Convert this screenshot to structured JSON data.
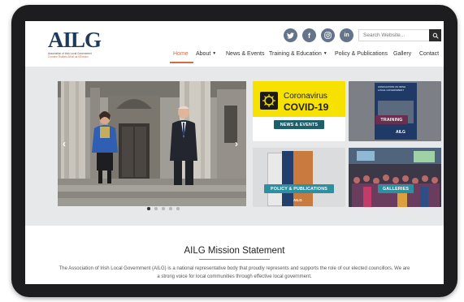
{
  "brand": {
    "logo_text": "AILG",
    "logo_line1": "Association of Irish Local Government",
    "logo_line2": "Cumann Rialtais Áitiúil na hÉireann",
    "accent_color": "#d86a3c",
    "navy_color": "#1e3a5f"
  },
  "social": [
    {
      "icon": "twitter-icon",
      "glyph": "t"
    },
    {
      "icon": "facebook-icon",
      "glyph": "f"
    },
    {
      "icon": "instagram-icon",
      "glyph": "◎"
    },
    {
      "icon": "linkedin-icon",
      "glyph": "in"
    }
  ],
  "search": {
    "placeholder": "Search Website..."
  },
  "nav": [
    {
      "label": "Home",
      "active": true
    },
    {
      "label": "About",
      "dropdown": true
    },
    {
      "label": "News & Events"
    },
    {
      "label": "Training & Education",
      "dropdown": true
    },
    {
      "label": "Policy & Publications"
    },
    {
      "label": "Gallery"
    },
    {
      "label": "Contact"
    }
  ],
  "tiles": {
    "covid_title1": "Coronavirus",
    "covid_title2": "COVID-19",
    "news": "NEWS & EVENTS",
    "training": "TRAINING",
    "training_doc": "ASSOCIATION OF IRISH LOCAL GOVERNMENT",
    "training_doc_logo": "AILG",
    "policy": "POLICY & PUBLICATIONS",
    "policy_doc_logo": "AILG",
    "galleries": "GALLERIES"
  },
  "slider": {
    "slide_count": 5,
    "current": 1
  },
  "mission": {
    "title": "AILG Mission Statement",
    "text": "The Association of Irish Local Government (AILG) is a national representative body that proudly represents and supports the role of our elected councillors. We are a strong voice for local communities through effective local government."
  }
}
